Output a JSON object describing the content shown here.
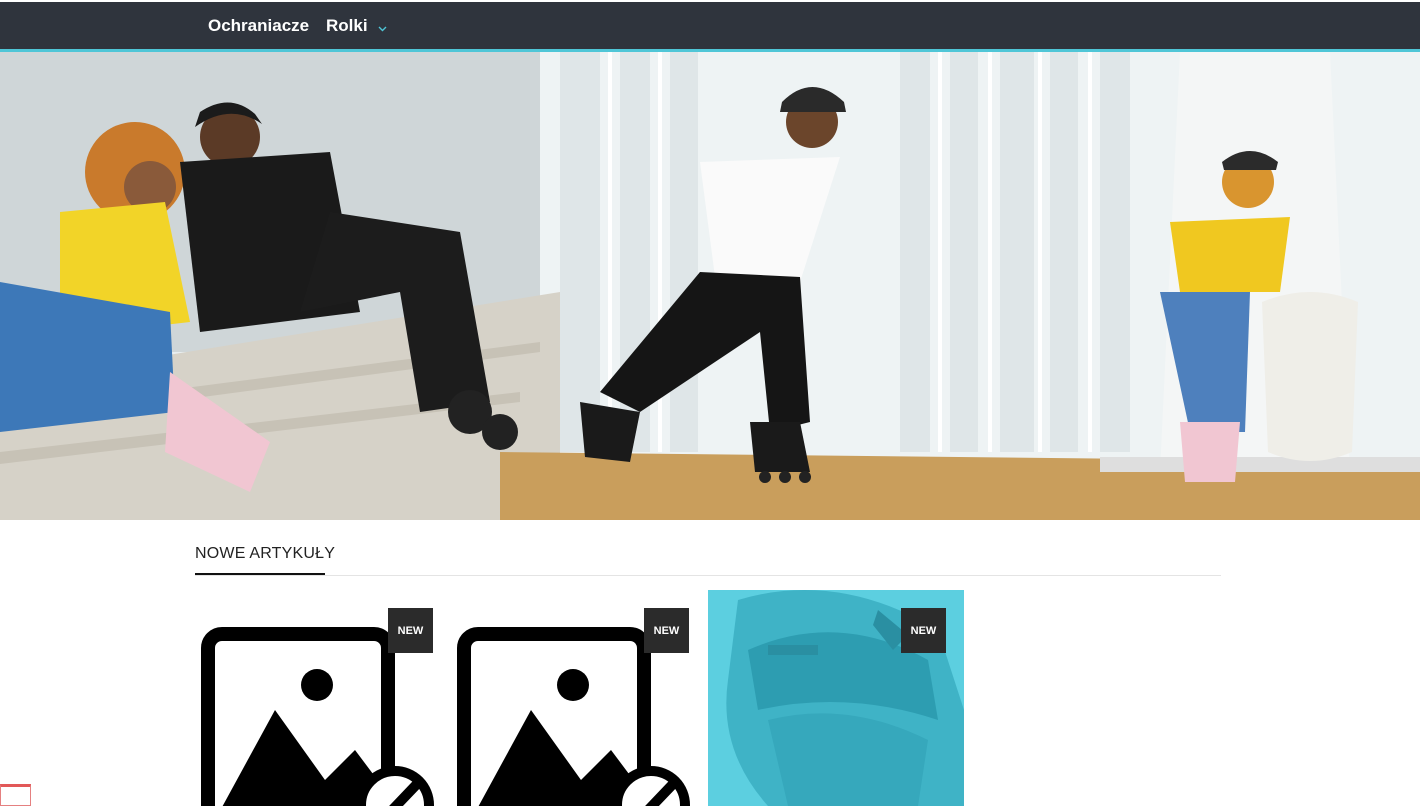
{
  "nav": {
    "items": [
      {
        "label": "Ochraniacze"
      },
      {
        "label": "Rolki",
        "has_dropdown": true,
        "icon": "chevron-down-icon"
      }
    ],
    "accent_color": "#4fc6d7",
    "background": "#2f343d"
  },
  "section": {
    "title": "NOWE ARTYKUŁY"
  },
  "products": [
    {
      "badge": "NEW",
      "image": "image-placeholder-icon"
    },
    {
      "badge": "NEW",
      "image": "image-placeholder-icon"
    },
    {
      "badge": "NEW",
      "image": "helmet-photo"
    }
  ]
}
